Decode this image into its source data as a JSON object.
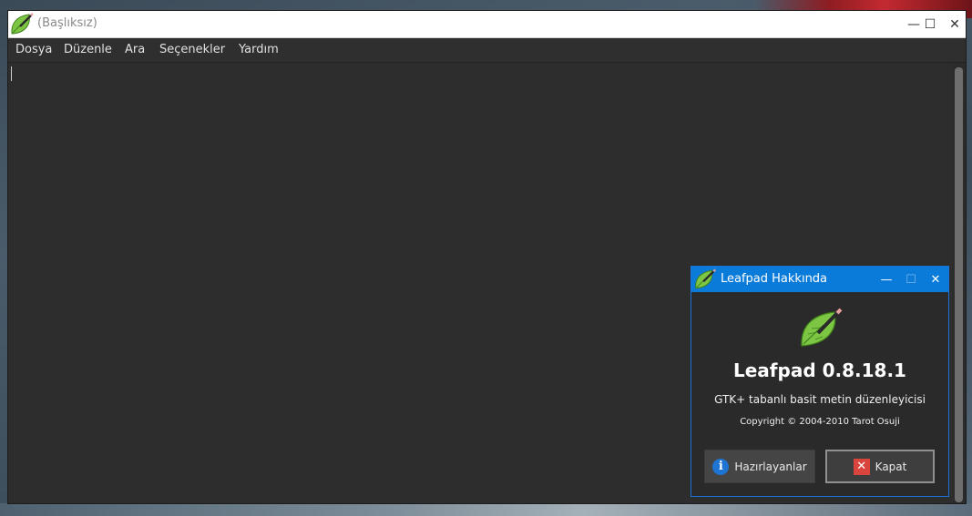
{
  "main_window": {
    "title": "(Başlıksız)",
    "controls": {
      "minimize": "—",
      "maximize": "☐",
      "close": "✕"
    },
    "menu": [
      "Dosya",
      "Düzenle",
      "Ara",
      "Seçenekler",
      "Yardım"
    ],
    "editor_text": ""
  },
  "about_dialog": {
    "title": "Leafpad Hakkında",
    "controls": {
      "minimize": "—",
      "maximize": "☐",
      "close": "✕"
    },
    "app_name": "Leafpad 0.8.18.1",
    "description": "GTK+ tabanlı basit metin düzenleyicisi",
    "copyright": "Copyright © 2004-2010 Tarot Osuji",
    "buttons": {
      "credits": "Hazırlayanlar",
      "close": "Kapat"
    }
  },
  "colors": {
    "accent": "#0a7bd8",
    "leaf": "#7cc644",
    "editor_bg": "#2d2d2d"
  },
  "icons": {
    "app": "leafpad-leaf-icon",
    "info": "info-icon",
    "close_button": "close-x-icon"
  }
}
